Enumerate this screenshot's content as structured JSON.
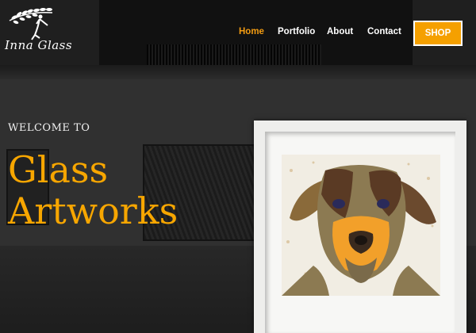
{
  "brand": {
    "logo_text": "Inna Glass",
    "accent_color": "#f7a600"
  },
  "nav": {
    "items": [
      {
        "label": "Home",
        "active": true
      },
      {
        "label": "Portfolio",
        "active": false
      },
      {
        "label": "About",
        "active": false
      },
      {
        "label": "Contact",
        "active": false
      }
    ],
    "shop_label": "SHOP"
  },
  "hero": {
    "welcome": "WELCOME TO",
    "title_line1": "Glass",
    "title_line2": "Artworks",
    "featured_image": "glass-dog-artwork"
  },
  "icons": {
    "logo": "dancer-with-branch-icon"
  }
}
